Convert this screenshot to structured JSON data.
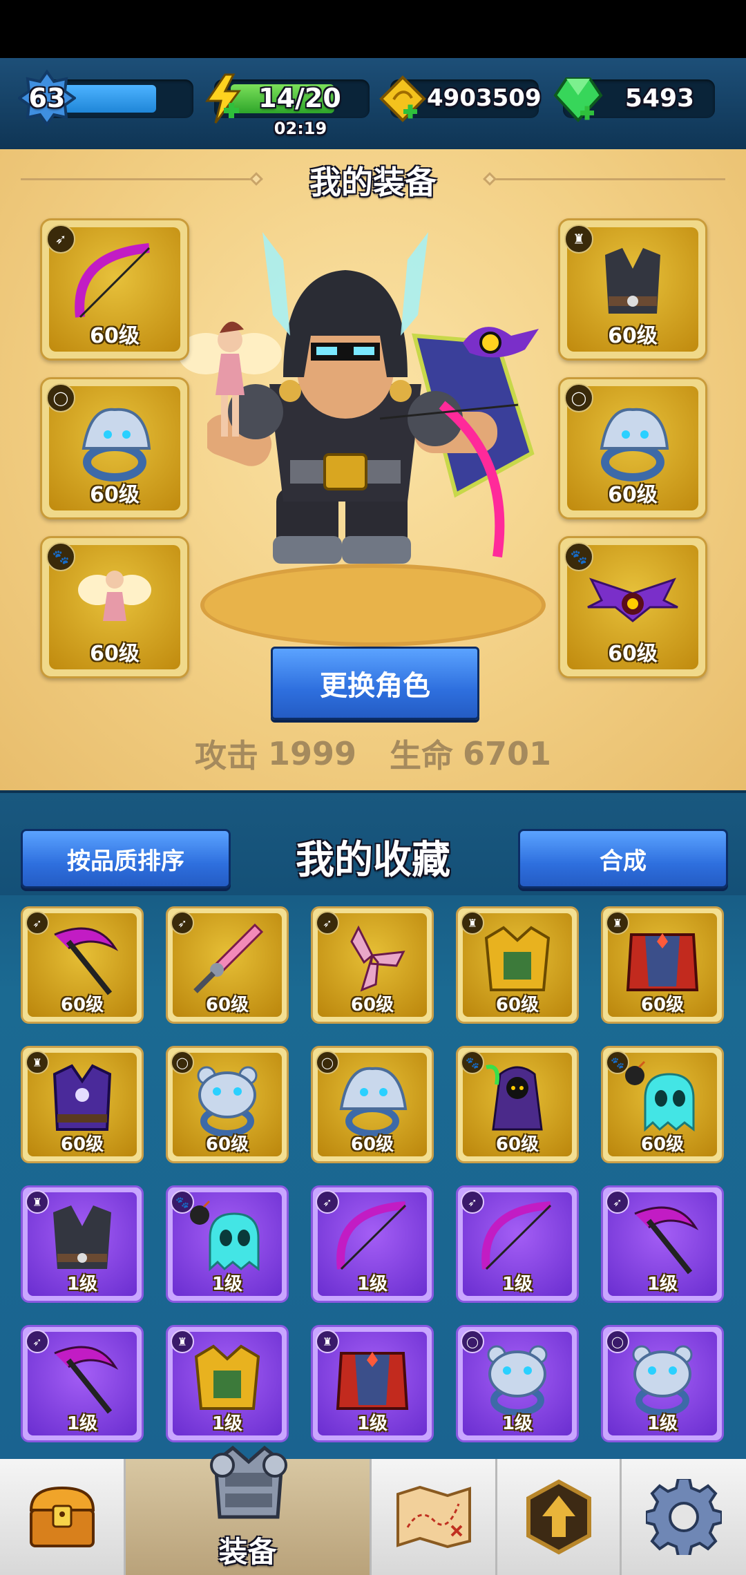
{
  "top_bar": {
    "player_level": "63",
    "energy": "14/20",
    "energy_timer": "02:19",
    "gold": "4903509",
    "gems": "5493"
  },
  "equipment": {
    "title": "我的装备",
    "change_role_label": "更换角色",
    "stats": {
      "attack_label": "攻击",
      "attack_value": "1999",
      "hp_label": "生命",
      "hp_value": "6701"
    },
    "slots": [
      {
        "slot": "weapon",
        "icon": "bow-icon",
        "level": "60级",
        "rarity": "gold"
      },
      {
        "slot": "ring",
        "icon": "wolf-ring-icon",
        "level": "60级",
        "rarity": "gold"
      },
      {
        "slot": "pet",
        "icon": "fairy-icon",
        "level": "60级",
        "rarity": "gold"
      },
      {
        "slot": "armor",
        "icon": "dark-vest-icon",
        "level": "60级",
        "rarity": "gold"
      },
      {
        "slot": "ring",
        "icon": "wolf-ring-icon",
        "level": "60级",
        "rarity": "gold"
      },
      {
        "slot": "pet",
        "icon": "bat-icon",
        "level": "60级",
        "rarity": "gold"
      }
    ]
  },
  "collection": {
    "title": "我的收藏",
    "sort_label": "按品质排序",
    "merge_label": "合成",
    "items": [
      {
        "icon": "scythe-icon",
        "level": "60级",
        "rarity": "gold",
        "badge": "weapon"
      },
      {
        "icon": "sword-icon",
        "level": "60级",
        "rarity": "gold",
        "badge": "weapon"
      },
      {
        "icon": "boomerang-icon",
        "level": "60级",
        "rarity": "gold",
        "badge": "weapon"
      },
      {
        "icon": "gold-armor-icon",
        "level": "60级",
        "rarity": "gold",
        "badge": "armor"
      },
      {
        "icon": "red-cape-icon",
        "level": "60级",
        "rarity": "gold",
        "badge": "armor"
      },
      {
        "icon": "purple-robe-icon",
        "level": "60级",
        "rarity": "gold",
        "badge": "armor"
      },
      {
        "icon": "bear-ring-icon",
        "level": "60级",
        "rarity": "gold",
        "badge": "ring"
      },
      {
        "icon": "wolf-ring-icon",
        "level": "60级",
        "rarity": "gold",
        "badge": "ring"
      },
      {
        "icon": "reaper-icon",
        "level": "60级",
        "rarity": "gold",
        "badge": "pet"
      },
      {
        "icon": "bomb-ghost-icon",
        "level": "60级",
        "rarity": "gold",
        "badge": "pet"
      },
      {
        "icon": "dark-vest-icon",
        "level": "1级",
        "rarity": "purple",
        "badge": "armor"
      },
      {
        "icon": "bomb-ghost-icon",
        "level": "1级",
        "rarity": "purple",
        "badge": "pet"
      },
      {
        "icon": "bow-icon",
        "level": "1级",
        "rarity": "purple",
        "badge": "weapon"
      },
      {
        "icon": "bow-icon",
        "level": "1级",
        "rarity": "purple",
        "badge": "weapon"
      },
      {
        "icon": "scythe-icon",
        "level": "1级",
        "rarity": "purple",
        "badge": "weapon"
      },
      {
        "icon": "scythe-icon",
        "level": "1级",
        "rarity": "purple",
        "badge": "weapon"
      },
      {
        "icon": "gold-armor-icon",
        "level": "1级",
        "rarity": "purple",
        "badge": "armor"
      },
      {
        "icon": "red-cape-icon",
        "level": "1级",
        "rarity": "purple",
        "badge": "armor"
      },
      {
        "icon": "bear-ring-icon",
        "level": "1级",
        "rarity": "purple",
        "badge": "ring"
      },
      {
        "icon": "bear-ring-icon",
        "level": "1级",
        "rarity": "purple",
        "badge": "ring"
      }
    ]
  },
  "bottom_nav": {
    "tabs": [
      {
        "name": "chest",
        "label": ""
      },
      {
        "name": "equipment",
        "label": "装备",
        "active": true
      },
      {
        "name": "map",
        "label": ""
      },
      {
        "name": "upgrade",
        "label": ""
      },
      {
        "name": "settings",
        "label": ""
      }
    ]
  },
  "colors": {
    "gold_card": "#e2bb34",
    "purple_card": "#8e4ce8",
    "blue_button": "#3a7ff0",
    "panel_bg": "#f3d48d"
  }
}
